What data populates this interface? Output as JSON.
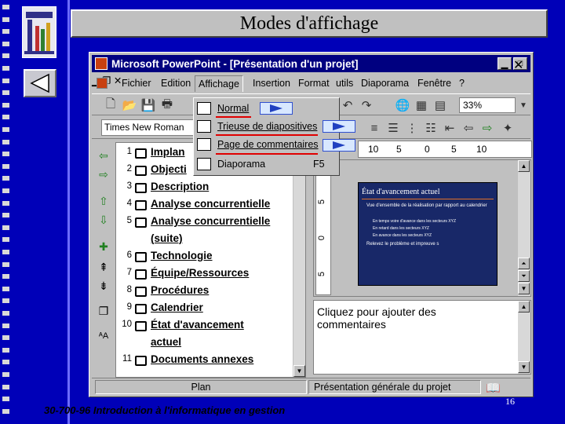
{
  "slide": {
    "title": "Modes d'affichage",
    "footer": "30-700-96 Introduction à l'informatique en gestion",
    "page_number": "16"
  },
  "window": {
    "title": "Microsoft PowerPoint - [Présentation d'un projet]"
  },
  "menu": {
    "fichier": "Fichier",
    "edition": "Edition",
    "affichage": "Affichage",
    "insertion": "Insertion",
    "format": "Format",
    "outils": "utils",
    "diaporama": "Diaporama",
    "fenetre": "Fenêtre",
    "help": "?"
  },
  "toolbar": {
    "zoom": "33%",
    "font": "Times New Roman"
  },
  "view_menu": {
    "items": [
      {
        "label": "Normal",
        "icon": "normal-view-icon"
      },
      {
        "label": "Trieuse de diapositives",
        "icon": "slide-sorter-icon"
      },
      {
        "label": "Page de commentaires",
        "icon": "notes-page-icon"
      },
      {
        "label": "Diaporama",
        "shortcut": "F5",
        "icon": "slideshow-icon"
      }
    ]
  },
  "outline": {
    "items": [
      {
        "num": "1",
        "text": "Implan"
      },
      {
        "num": "2",
        "text": "Objecti"
      },
      {
        "num": "3",
        "text": "Description"
      },
      {
        "num": "4",
        "text": "Analyse concurrentielle"
      },
      {
        "num": "5",
        "text": "Analyse concurrentielle",
        "text2": "(suite)"
      },
      {
        "num": "6",
        "text": "Technologie"
      },
      {
        "num": "7",
        "text": "Équipe/Ressources"
      },
      {
        "num": "8",
        "text": "Procédures"
      },
      {
        "num": "9",
        "text": "Calendrier"
      },
      {
        "num": "10",
        "text": "État d'avancement",
        "text2": "actuel"
      },
      {
        "num": "11",
        "text": "Documents annexes"
      }
    ]
  },
  "ruler": {
    "h_ticks": [
      "10",
      "5",
      "0",
      "5",
      "10"
    ],
    "v_ticks": [
      "5",
      "0",
      "5"
    ]
  },
  "slide_preview": {
    "title": "État d'avancement actuel",
    "bullets": [
      "Vue d'ensemble de la réalisation par rapport au calendrier",
      "En temps voire d'avance dans les secteurs XYZ",
      "En retard dans les secteurs XYZ",
      "En avance dans les secteurs XYZ",
      "Relevez le problème et impreuve s"
    ]
  },
  "notes": {
    "placeholder": "Cliquez pour ajouter des commentaires"
  },
  "statusbar": {
    "view": "Plan",
    "template": "Présentation générale du projet"
  }
}
